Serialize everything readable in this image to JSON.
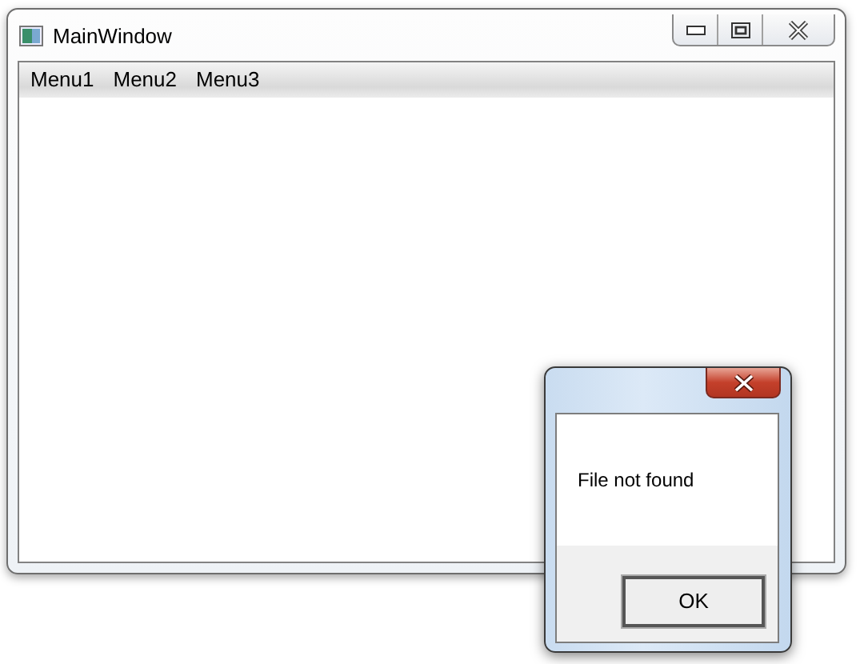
{
  "main_window": {
    "title": "MainWindow",
    "menu": [
      "Menu1",
      "Menu2",
      "Menu3"
    ]
  },
  "dialog": {
    "message": "File not found",
    "buttons": [
      "OK"
    ]
  }
}
